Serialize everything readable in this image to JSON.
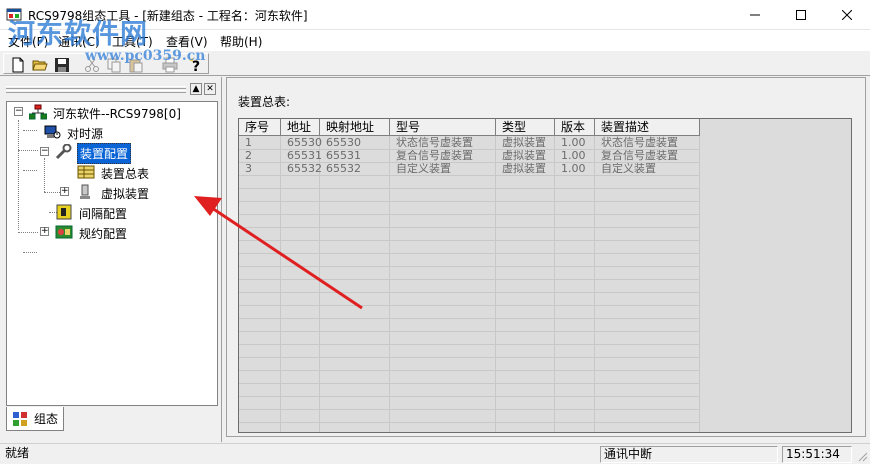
{
  "window": {
    "title": "RCS9798组态工具 - [新建组态 - 工程名：河东软件]",
    "watermark": "河东软件网",
    "watermark_url": "www.pc0359.cn"
  },
  "menu": [
    {
      "label": "文件(F)"
    },
    {
      "label": "通讯(C)"
    },
    {
      "label": "工具(T)"
    },
    {
      "label": "查看(V)"
    },
    {
      "label": "帮助(H)"
    }
  ],
  "toolbar": {
    "icons": [
      "new-file-icon",
      "open-folder-icon",
      "save-icon",
      "cut-icon",
      "copy-icon",
      "paste-icon",
      "print-icon",
      "help-icon"
    ]
  },
  "tree": {
    "root": "河东软件--RCS9798[0]",
    "items": [
      {
        "label": "对时源"
      },
      {
        "label": "装置配置"
      },
      {
        "label": "装置总表"
      },
      {
        "label": "虚拟装置"
      },
      {
        "label": "间隔配置"
      },
      {
        "label": "规约配置"
      }
    ],
    "expanders": [
      "−",
      "−",
      "+",
      "+"
    ],
    "pane_buttons": [
      "▲",
      "✕"
    ]
  },
  "tab": {
    "label": "组态"
  },
  "main": {
    "section_title": "装置总表:",
    "columns": [
      "序号",
      "地址",
      "映射地址",
      "型号",
      "类型",
      "版本",
      "装置描述"
    ],
    "rows": [
      [
        "1",
        "65530",
        "65530",
        "状态信号虚装置",
        "虚拟装置",
        "1.00",
        "状态信号虚装置"
      ],
      [
        "2",
        "65531",
        "65531",
        "复合信号虚装置",
        "虚拟装置",
        "1.00",
        "复合信号虚装置"
      ],
      [
        "3",
        "65532",
        "65532",
        "自定义装置",
        "虚拟装置",
        "1.00",
        "自定义装置"
      ]
    ]
  },
  "status": {
    "left": "就绪",
    "comm": "通讯中断",
    "time": "15:51:34"
  },
  "colors": {
    "selection": "#0a64d6",
    "annotation_arrow": "#e02020",
    "watermark": "#2f7dd7"
  }
}
